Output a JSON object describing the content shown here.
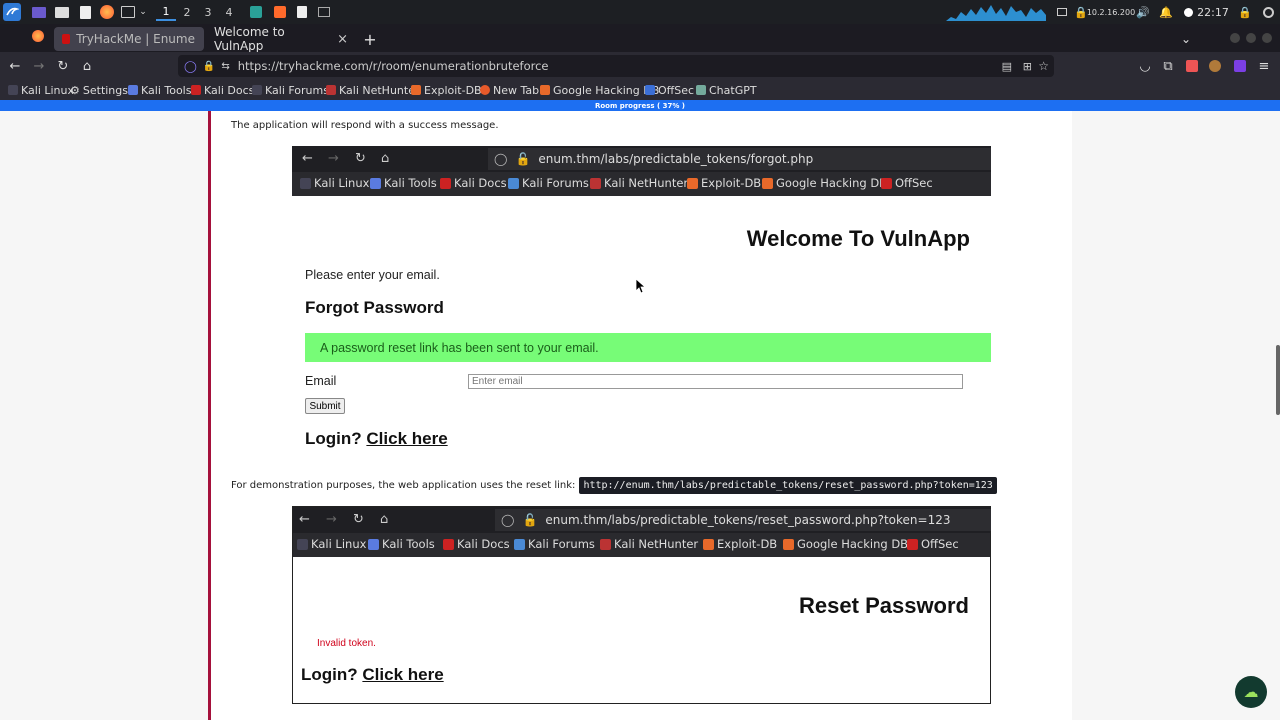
{
  "panel": {
    "workspaces": [
      "1",
      "2",
      "3",
      "4"
    ],
    "ip": "10.2.16.200",
    "time": "22:17"
  },
  "tabs": [
    {
      "title": "TryHackMe | Enumeratio"
    },
    {
      "title": "Welcome to VulnApp"
    }
  ],
  "new_tab": "+",
  "url": "https://tryhackme.com/r/room/enumerationbruteforce",
  "bookmarks": [
    "Kali Linux",
    "Settings",
    "Kali Tools",
    "Kali Docs",
    "Kali Forums",
    "Kali NetHunter",
    "Exploit-DB",
    "New Tab",
    "Google Hacking DB",
    "OffSec",
    "ChatGPT"
  ],
  "progress": "Room progress ( 37% )",
  "content": {
    "para1": "The application will respond with a success message.",
    "para2": "For demonstration purposes, the web application uses the reset link:",
    "code": "http://enum.thm/labs/predictable_tokens/reset_password.php?token=123"
  },
  "shot1": {
    "url": "enum.thm/labs/predictable_tokens/forgot.php",
    "bookmarks": [
      "Kali Linux",
      "Kali Tools",
      "Kali Docs",
      "Kali Forums",
      "Kali NetHunter",
      "Exploit-DB",
      "Google Hacking DB",
      "OffSec"
    ],
    "welcome": "Welcome To VulnApp",
    "prompt": "Please enter your email.",
    "heading": "Forgot Password",
    "alert": "A password reset link has been sent to your email.",
    "email_label": "Email",
    "email_placeholder": "Enter email",
    "submit": "Submit",
    "login_prefix": "Login?",
    "login_link": "Click here"
  },
  "shot2": {
    "url": "enum.thm/labs/predictable_tokens/reset_password.php?token=123",
    "bookmarks": [
      "Kali Linux",
      "Kali Tools",
      "Kali Docs",
      "Kali Forums",
      "Kali NetHunter",
      "Exploit-DB",
      "Google Hacking DB",
      "OffSec"
    ],
    "heading": "Reset Password",
    "error": "Invalid token.",
    "login_prefix": "Login?",
    "login_link": "Click here"
  },
  "colors": {
    "accent": "#1d6ff2",
    "card_border": "#a5113b",
    "alert_bg": "#77fc77",
    "error": "#d0021b"
  }
}
